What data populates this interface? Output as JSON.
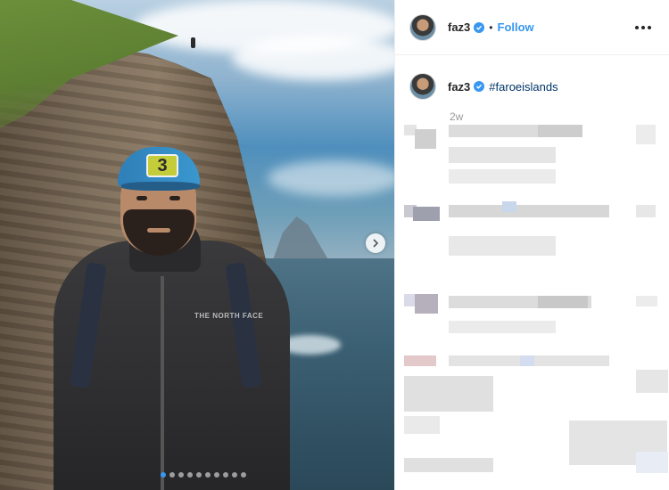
{
  "post": {
    "username": "faz3",
    "follow_label": "Follow",
    "separator": "•",
    "caption_hashtag": "#faroeislands",
    "timestamp": "2w",
    "cap_number": "3",
    "jacket_brand": "THE NORTH FACE",
    "carousel": {
      "total_images": 10,
      "active_index": 0
    }
  },
  "colors": {
    "accent_blue": "#3897f0",
    "hashtag_blue": "#003569",
    "text": "#262626",
    "muted": "#999999",
    "blur_gray": "#d9d9d9"
  },
  "icons": {
    "verified": "verified-badge-icon",
    "more": "more-options-icon",
    "next": "chevron-right-icon"
  }
}
